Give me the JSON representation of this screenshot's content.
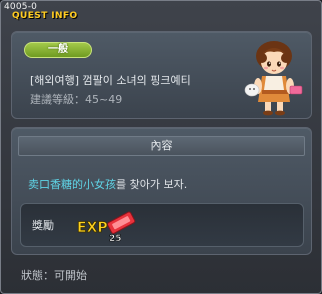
{
  "window": {
    "quest_id": "4005-0",
    "title": "QUEST INFO"
  },
  "quest": {
    "category_badge": "一般",
    "name": "[해외여행] 껌팔이 소녀의 핑크예티",
    "level_text": "建議等級：45~49"
  },
  "content": {
    "header": "內容",
    "description_highlight": "卖口香糖的小女孩",
    "description_rest": "를 찾아가 보자."
  },
  "reward": {
    "label": "獎勵",
    "exp_label": "EXP",
    "exp_count": "25"
  },
  "status": {
    "text": "狀態：可開始"
  },
  "colors": {
    "title": "#ffcc22",
    "badge": "#8ab53a",
    "highlight": "#5fd4e6"
  },
  "icons": {
    "npc": "npc-girl-portrait",
    "reward": "exp-ticket-icon"
  }
}
